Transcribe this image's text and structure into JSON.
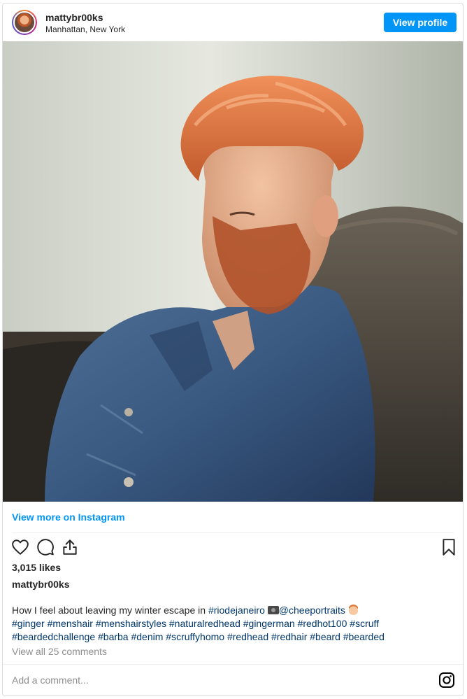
{
  "header": {
    "username": "mattybr00ks",
    "location": "Manhattan, New York",
    "view_profile_label": "View profile"
  },
  "post": {
    "view_more_label": "View more on Instagram",
    "likes": "3,015 likes",
    "caption_user": "mattybr00ks",
    "caption_text": "How I feel about leaving my winter escape in",
    "caption_tag_location": "#riodejaneiro",
    "caption_mention": "@cheeportraits",
    "hashtags_line1": "#ginger #menshair #menshairstyles #naturalredhead #gingerman #redhot100 #scruff",
    "hashtags_line2": "#beardedchallenge #barba #denim #scruffyhomo #redhead #redhair #beard #bearded",
    "view_all_comments": "View all 25 comments",
    "comment_placeholder": "Add a comment..."
  },
  "icons": [
    "heart-icon",
    "comment-icon",
    "share-icon",
    "bookmark-icon",
    "instagram-icon"
  ],
  "colors": {
    "accent": "#0095f6",
    "hashtag": "#00376b",
    "muted": "#8e8e8e",
    "border": "#dbdbdb"
  }
}
